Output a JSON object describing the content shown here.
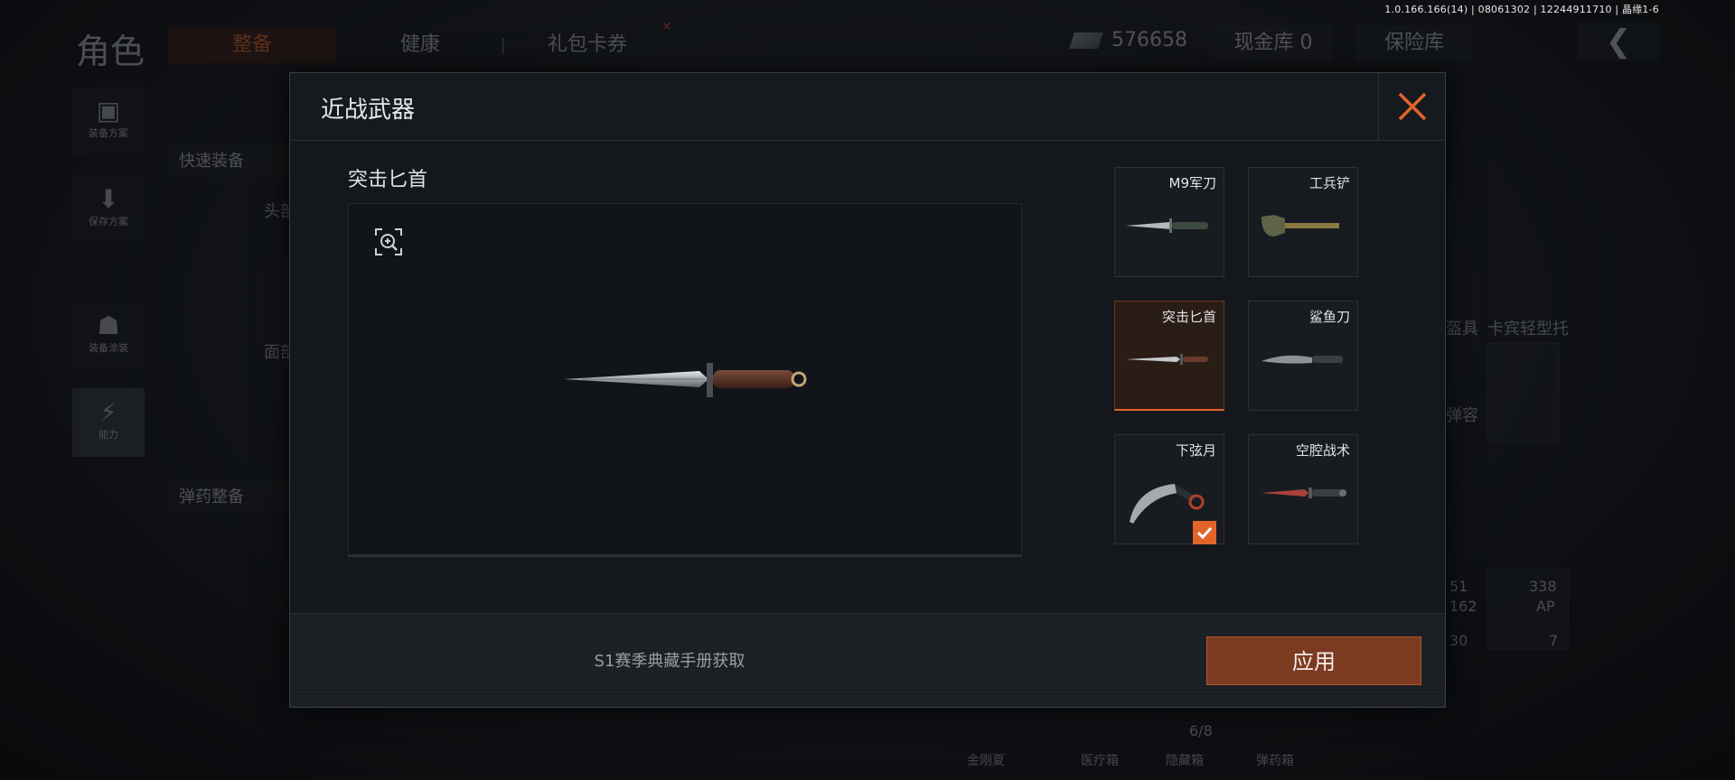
{
  "version_info": "1.0.166.166(14) | 08061302 | 12244911710 | 晶缘1-6",
  "topbar": {
    "title": "角色",
    "tabs": [
      "整备",
      "健康",
      "礼包卡券"
    ],
    "money": "576658",
    "cash_vault": "现金库 0",
    "safe_vault": "保险库",
    "back_icon": "back-arrow-icon"
  },
  "sidebar": {
    "items": [
      "装备方案",
      "保存方案",
      "装备涂装",
      "能力"
    ]
  },
  "background": {
    "quick_equip": "快速装备",
    "ammo_equip": "弹药整备",
    "slot_head": "头部",
    "slot_face": "面部",
    "helmet_label": "盔具",
    "mount_label": "卡宾轻型托",
    "ammo_label": "弹容",
    "counts": [
      "51",
      "162",
      "30",
      "338",
      "AP",
      "7"
    ],
    "capacity": "6/8",
    "bottom_tabs": [
      "金刚夏",
      "医疗箱",
      "隐藏箱",
      "弹药箱"
    ]
  },
  "modal": {
    "title": "近战武器",
    "close_icon": "close-icon",
    "preview": {
      "title": "突击匕首",
      "zoom_icon": "zoom-in-icon"
    },
    "weapons": [
      {
        "name": "M9军刀",
        "icon": "bayonet-icon",
        "selected": false,
        "equipped": false
      },
      {
        "name": "工兵铲",
        "icon": "shovel-icon",
        "selected": false,
        "equipped": false
      },
      {
        "name": "突击匕首",
        "icon": "dagger-icon",
        "selected": true,
        "equipped": false
      },
      {
        "name": "鲨鱼刀",
        "icon": "shark-knife-icon",
        "selected": false,
        "equipped": false
      },
      {
        "name": "下弦月",
        "icon": "karambit-icon",
        "selected": false,
        "equipped": true
      },
      {
        "name": "空腔战术",
        "icon": "tactical-knife-icon",
        "selected": false,
        "equipped": false
      }
    ],
    "source_text": "S1赛季典藏手册获取",
    "apply_label": "应用"
  },
  "colors": {
    "accent": "#e2642b",
    "apply_bg": "#7c3a21",
    "panel_bg": "#14181c"
  }
}
